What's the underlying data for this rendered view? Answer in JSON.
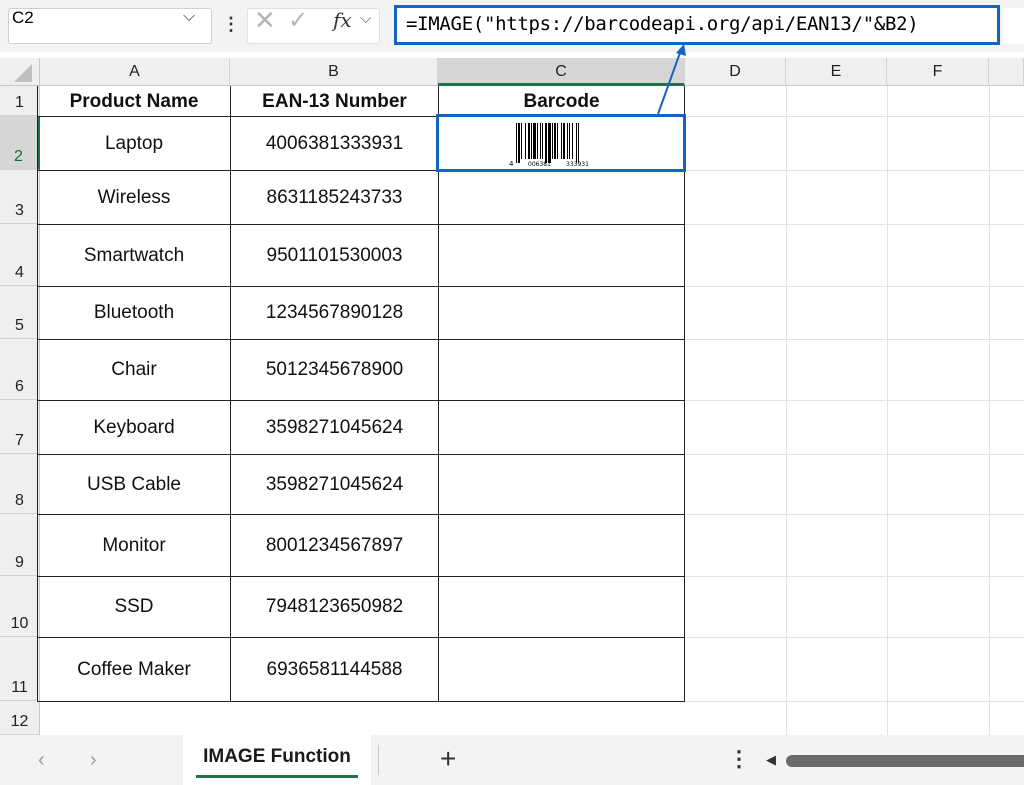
{
  "formula_bar": {
    "name_box": "C2",
    "formula": "=IMAGE(\"https://barcodeapi.org/api/EAN13/\"&B2)",
    "icons": [
      "cancel-icon",
      "enter-check-icon",
      "fx-icon"
    ]
  },
  "columns": [
    "A",
    "B",
    "C",
    "D",
    "E",
    "F"
  ],
  "rows": [
    "1",
    "2",
    "3",
    "4",
    "5",
    "6",
    "7",
    "8",
    "9",
    "10",
    "11",
    "12"
  ],
  "table": {
    "headers": [
      "Product Name",
      "EAN-13 Number",
      "Barcode"
    ],
    "rows": [
      {
        "product": "Laptop",
        "ean": "4006381333931"
      },
      {
        "product": "Wireless",
        "ean": "8631185243733"
      },
      {
        "product": "Smartwatch",
        "ean": "9501101530003"
      },
      {
        "product": "Bluetooth",
        "ean": "1234567890128"
      },
      {
        "product": "Chair",
        "ean": "5012345678900"
      },
      {
        "product": "Keyboard",
        "ean": "3598271045624"
      },
      {
        "product": "USB Cable",
        "ean": "3598271045624"
      },
      {
        "product": "Monitor",
        "ean": "8001234567897"
      },
      {
        "product": "SSD",
        "ean": "7948123650982"
      },
      {
        "product": "Coffee Maker",
        "ean": "6936581144588"
      }
    ]
  },
  "barcode": {
    "digit_first": "4",
    "group1": "006381",
    "group2": "333931"
  },
  "sheet_tabs": {
    "active": "IMAGE Function",
    "add_icon": "+"
  },
  "colors": {
    "accent": "#1565c0",
    "excel_green": "#217346"
  }
}
